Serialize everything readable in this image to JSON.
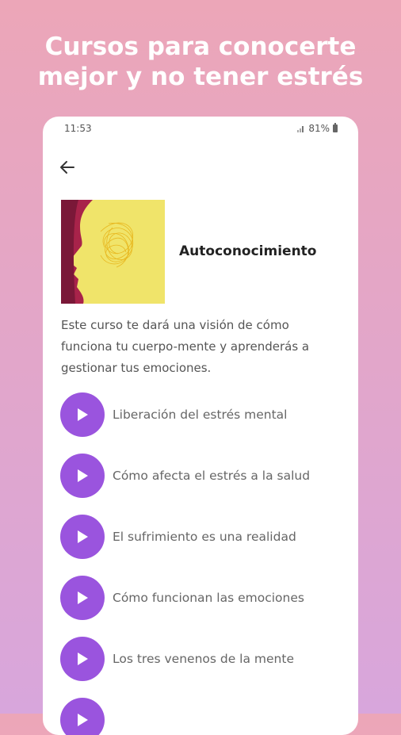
{
  "promo": {
    "line1": "Cursos para conocerte",
    "line2": "mejor y no tener estrés"
  },
  "status_bar": {
    "time": "11:53",
    "battery": "81%"
  },
  "icons": {
    "back": "arrow-left-icon",
    "play": "play-icon"
  },
  "course": {
    "title": "Autoconocimiento",
    "description": "Este curso te dará una visión de cómo funciona tu cuerpo-mente y aprenderás a gestionar tus emociones."
  },
  "lessons": [
    {
      "label": "Liberación del estrés mental"
    },
    {
      "label": "Cómo afecta el estrés a la salud"
    },
    {
      "label": "El sufrimiento es una realidad"
    },
    {
      "label": "Cómo funcionan las emociones"
    },
    {
      "label": "Los tres venenos de la mente"
    },
    {
      "label": ""
    }
  ],
  "colors": {
    "accent": "#9a54de",
    "thumb_bg": "#f0e46a",
    "thumb_head": "#a8234a"
  }
}
